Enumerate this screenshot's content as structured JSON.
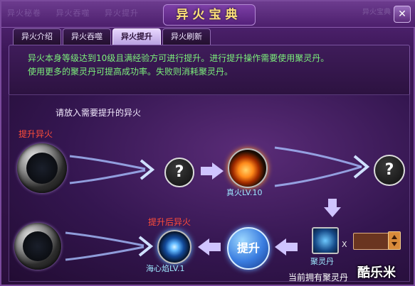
{
  "window": {
    "title": "异火宝典",
    "close_glyph": "✕"
  },
  "ghost_tabs": [
    "异火秘卷",
    "异火吞噬",
    "异火提升"
  ],
  "ghost_right": "异火宝典",
  "tabs": [
    {
      "label": "异火介绍",
      "active": false
    },
    {
      "label": "异火吞噬",
      "active": false
    },
    {
      "label": "异火提升",
      "active": true
    },
    {
      "label": "异火刷新",
      "active": false
    }
  ],
  "description": {
    "line1": "异火本身等级达到10级且满经验方可进行提升。进行提升操作需要使用聚灵丹。",
    "line2": "使用更多的聚灵丹可提高成功率。失败则消耗聚灵丹。"
  },
  "prompt": "请放入需要提升的异火",
  "labels": {
    "upgrade_fire": "提升异火",
    "upgraded_fire": "提升后异火",
    "zhenhuo": "真火LV.10",
    "haixinyan": "海心焰LV.1",
    "julingdan": "聚灵丹",
    "qty_x": "X",
    "unknown": "?"
  },
  "upgrade_button": "提升",
  "quantity": {
    "value": ""
  },
  "footer": {
    "count_text": "当前拥有聚灵丹"
  },
  "watermark": "酷乐米",
  "colors": {
    "desc_text": "#7cf07b",
    "label_red": "#ff4d3a",
    "label_cyan": "#9ee8ff",
    "title": "#ffe27a"
  }
}
